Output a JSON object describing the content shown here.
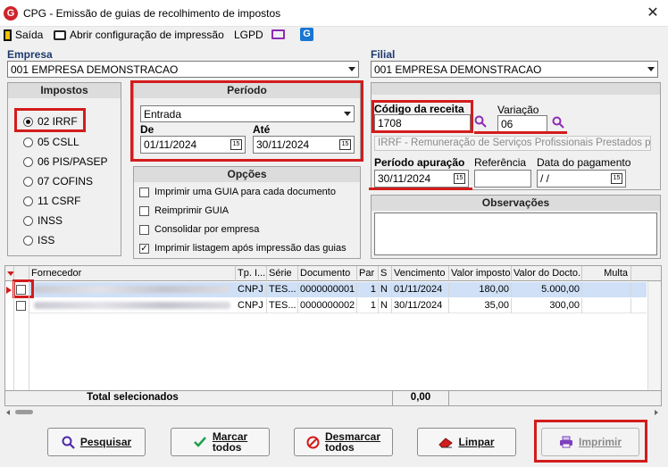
{
  "window": {
    "title": "CPG - Emissão de guias de recolhimento de impostos",
    "close": "✕",
    "logo_letter": "G"
  },
  "toolbar": {
    "saida": "Saída",
    "abrir_config": "Abrir configuração de impressão",
    "lgpd": "LGPD"
  },
  "empresa": {
    "label": "Empresa",
    "value": "001 EMPRESA DEMONSTRACAO"
  },
  "filial": {
    "label": "Filial",
    "value": "001 EMPRESA DEMONSTRACAO"
  },
  "impostos": {
    "title": "Impostos",
    "options": [
      "02 IRRF",
      "05 CSLL",
      "06 PIS/PASEP",
      "07 COFINS",
      "11 CSRF",
      "INSS",
      "ISS"
    ],
    "selected": "02 IRRF"
  },
  "periodo": {
    "title": "Período",
    "tipo": "Entrada",
    "de_label": "De",
    "de_value": "01/11/2024",
    "ate_label": "Até",
    "ate_value": "30/11/2024",
    "cal_icon": "15"
  },
  "opcoes": {
    "title": "Opções",
    "items": [
      {
        "label": "Imprimir uma GUIA para cada documento",
        "checked": false
      },
      {
        "label": "Reimprimir GUIA",
        "checked": false
      },
      {
        "label": "Consolidar por empresa",
        "checked": false
      },
      {
        "label": "Imprimir listagem após impressão das guias",
        "checked": true
      }
    ]
  },
  "receita": {
    "codigo_label": "Código da receita",
    "codigo_value": "1708",
    "variacao_label": "Variação",
    "variacao_value": "06",
    "descricao": "IRRF - Remuneração de Serviços Profissionais Prestados por Pe",
    "periodo_label": "Período apuração",
    "periodo_value": "30/11/2024",
    "referencia_label": "Referência",
    "referencia_value": "",
    "pagamento_label": "Data do pagamento",
    "pagamento_value": " /  /"
  },
  "observacoes": {
    "title": "Observações",
    "value": ""
  },
  "table": {
    "columns": [
      "Fornecedor",
      "Tp. I...",
      "Série",
      "Documento",
      "Par",
      "S",
      "Vencimento",
      "Valor imposto",
      "Valor do Docto.",
      "Multa"
    ],
    "rows": [
      {
        "tipo": "CNPJ",
        "serie": "TES...",
        "documento": "0000000001",
        "par": "1",
        "s": "N",
        "vencimento": "01/11/2024",
        "valor_imposto": "180,00",
        "valor_docto": "5.000,00",
        "multa": ""
      },
      {
        "tipo": "CNPJ",
        "serie": "TES...",
        "documento": "0000000002",
        "par": "1",
        "s": "N",
        "vencimento": "30/11/2024",
        "valor_imposto": "35,00",
        "valor_docto": "300,00",
        "multa": ""
      }
    ],
    "total_label": "Total selecionados",
    "total_value": "0,00"
  },
  "buttons": {
    "pesquisar": "Pesquisar",
    "marcar_l1": "Marcar",
    "marcar_l2": "todos",
    "desmarcar_l1": "Desmarcar",
    "desmarcar_l2": "todos",
    "limpar": "Limpar",
    "imprimir": "Imprimir"
  },
  "colors": {
    "red_highlight": "#d31c1c",
    "selected_row": "#cfe0f7",
    "label_blue": "#1e3a6e"
  }
}
